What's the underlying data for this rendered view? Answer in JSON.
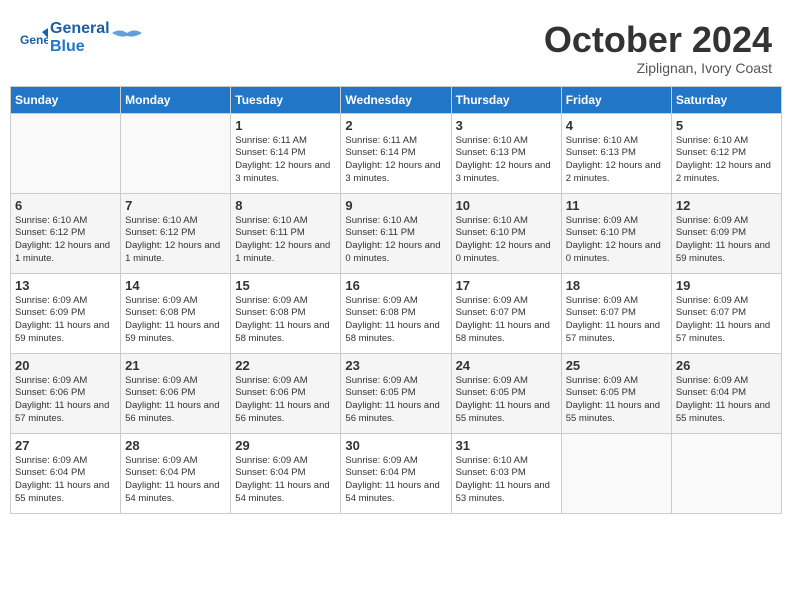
{
  "header": {
    "logo_line1": "General",
    "logo_line2": "Blue",
    "month": "October 2024",
    "location": "Ziplignan, Ivory Coast"
  },
  "weekdays": [
    "Sunday",
    "Monday",
    "Tuesday",
    "Wednesday",
    "Thursday",
    "Friday",
    "Saturday"
  ],
  "weeks": [
    [
      {
        "day": "",
        "info": ""
      },
      {
        "day": "",
        "info": ""
      },
      {
        "day": "1",
        "info": "Sunrise: 6:11 AM\nSunset: 6:14 PM\nDaylight: 12 hours and 3 minutes."
      },
      {
        "day": "2",
        "info": "Sunrise: 6:11 AM\nSunset: 6:14 PM\nDaylight: 12 hours and 3 minutes."
      },
      {
        "day": "3",
        "info": "Sunrise: 6:10 AM\nSunset: 6:13 PM\nDaylight: 12 hours and 3 minutes."
      },
      {
        "day": "4",
        "info": "Sunrise: 6:10 AM\nSunset: 6:13 PM\nDaylight: 12 hours and 2 minutes."
      },
      {
        "day": "5",
        "info": "Sunrise: 6:10 AM\nSunset: 6:12 PM\nDaylight: 12 hours and 2 minutes."
      }
    ],
    [
      {
        "day": "6",
        "info": "Sunrise: 6:10 AM\nSunset: 6:12 PM\nDaylight: 12 hours and 1 minute."
      },
      {
        "day": "7",
        "info": "Sunrise: 6:10 AM\nSunset: 6:12 PM\nDaylight: 12 hours and 1 minute."
      },
      {
        "day": "8",
        "info": "Sunrise: 6:10 AM\nSunset: 6:11 PM\nDaylight: 12 hours and 1 minute."
      },
      {
        "day": "9",
        "info": "Sunrise: 6:10 AM\nSunset: 6:11 PM\nDaylight: 12 hours and 0 minutes."
      },
      {
        "day": "10",
        "info": "Sunrise: 6:10 AM\nSunset: 6:10 PM\nDaylight: 12 hours and 0 minutes."
      },
      {
        "day": "11",
        "info": "Sunrise: 6:09 AM\nSunset: 6:10 PM\nDaylight: 12 hours and 0 minutes."
      },
      {
        "day": "12",
        "info": "Sunrise: 6:09 AM\nSunset: 6:09 PM\nDaylight: 11 hours and 59 minutes."
      }
    ],
    [
      {
        "day": "13",
        "info": "Sunrise: 6:09 AM\nSunset: 6:09 PM\nDaylight: 11 hours and 59 minutes."
      },
      {
        "day": "14",
        "info": "Sunrise: 6:09 AM\nSunset: 6:08 PM\nDaylight: 11 hours and 59 minutes."
      },
      {
        "day": "15",
        "info": "Sunrise: 6:09 AM\nSunset: 6:08 PM\nDaylight: 11 hours and 58 minutes."
      },
      {
        "day": "16",
        "info": "Sunrise: 6:09 AM\nSunset: 6:08 PM\nDaylight: 11 hours and 58 minutes."
      },
      {
        "day": "17",
        "info": "Sunrise: 6:09 AM\nSunset: 6:07 PM\nDaylight: 11 hours and 58 minutes."
      },
      {
        "day": "18",
        "info": "Sunrise: 6:09 AM\nSunset: 6:07 PM\nDaylight: 11 hours and 57 minutes."
      },
      {
        "day": "19",
        "info": "Sunrise: 6:09 AM\nSunset: 6:07 PM\nDaylight: 11 hours and 57 minutes."
      }
    ],
    [
      {
        "day": "20",
        "info": "Sunrise: 6:09 AM\nSunset: 6:06 PM\nDaylight: 11 hours and 57 minutes."
      },
      {
        "day": "21",
        "info": "Sunrise: 6:09 AM\nSunset: 6:06 PM\nDaylight: 11 hours and 56 minutes."
      },
      {
        "day": "22",
        "info": "Sunrise: 6:09 AM\nSunset: 6:06 PM\nDaylight: 11 hours and 56 minutes."
      },
      {
        "day": "23",
        "info": "Sunrise: 6:09 AM\nSunset: 6:05 PM\nDaylight: 11 hours and 56 minutes."
      },
      {
        "day": "24",
        "info": "Sunrise: 6:09 AM\nSunset: 6:05 PM\nDaylight: 11 hours and 55 minutes."
      },
      {
        "day": "25",
        "info": "Sunrise: 6:09 AM\nSunset: 6:05 PM\nDaylight: 11 hours and 55 minutes."
      },
      {
        "day": "26",
        "info": "Sunrise: 6:09 AM\nSunset: 6:04 PM\nDaylight: 11 hours and 55 minutes."
      }
    ],
    [
      {
        "day": "27",
        "info": "Sunrise: 6:09 AM\nSunset: 6:04 PM\nDaylight: 11 hours and 55 minutes."
      },
      {
        "day": "28",
        "info": "Sunrise: 6:09 AM\nSunset: 6:04 PM\nDaylight: 11 hours and 54 minutes."
      },
      {
        "day": "29",
        "info": "Sunrise: 6:09 AM\nSunset: 6:04 PM\nDaylight: 11 hours and 54 minutes."
      },
      {
        "day": "30",
        "info": "Sunrise: 6:09 AM\nSunset: 6:04 PM\nDaylight: 11 hours and 54 minutes."
      },
      {
        "day": "31",
        "info": "Sunrise: 6:10 AM\nSunset: 6:03 PM\nDaylight: 11 hours and 53 minutes."
      },
      {
        "day": "",
        "info": ""
      },
      {
        "day": "",
        "info": ""
      }
    ]
  ]
}
